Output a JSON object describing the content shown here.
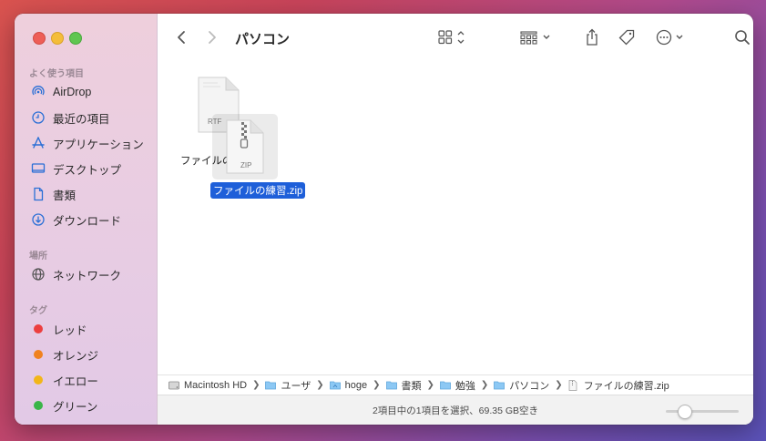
{
  "window": {
    "title": "パソコン"
  },
  "sidebar": {
    "favorites_header": "よく使う項目",
    "favorites": [
      {
        "label": "AirDrop",
        "icon": "airdrop-icon"
      },
      {
        "label": "最近の項目",
        "icon": "clock-icon"
      },
      {
        "label": "アプリケーション",
        "icon": "applications-icon"
      },
      {
        "label": "デスクトップ",
        "icon": "desktop-icon"
      },
      {
        "label": "書類",
        "icon": "document-icon"
      },
      {
        "label": "ダウンロード",
        "icon": "download-icon"
      }
    ],
    "locations_header": "場所",
    "locations": [
      {
        "label": "ネットワーク",
        "icon": "network-icon"
      }
    ],
    "tags_header": "タグ",
    "tags": [
      {
        "label": "レッド",
        "color": "#ec3f3f"
      },
      {
        "label": "オレンジ",
        "color": "#f0821f"
      },
      {
        "label": "イエロー",
        "color": "#f2b619"
      },
      {
        "label": "グリーン",
        "color": "#3ab549"
      }
    ]
  },
  "files": [
    {
      "name": "ファイルの",
      "badge": "RTF",
      "icon": "rtf-document-icon",
      "selected": false
    },
    {
      "name": "ファイルの練習.zip",
      "badge": "ZIP",
      "icon": "zip-archive-icon",
      "selected": true
    }
  ],
  "pathbar": [
    {
      "label": "Macintosh HD",
      "icon": "hard-drive-icon"
    },
    {
      "label": "ユーザ",
      "icon": "folder-icon"
    },
    {
      "label": "hoge",
      "icon": "home-folder-icon"
    },
    {
      "label": "書類",
      "icon": "folder-icon"
    },
    {
      "label": "勉強",
      "icon": "folder-icon"
    },
    {
      "label": "パソコン",
      "icon": "folder-icon"
    },
    {
      "label": "ファイルの練習.zip",
      "icon": "zip-file-icon"
    }
  ],
  "status": {
    "text": "2項目中の1項目を選択、69.35 GB空き",
    "zoom_level": 0.2
  },
  "colors": {
    "accent": "#1e5fd9",
    "sidebar_icon": "#2a6fd6"
  }
}
